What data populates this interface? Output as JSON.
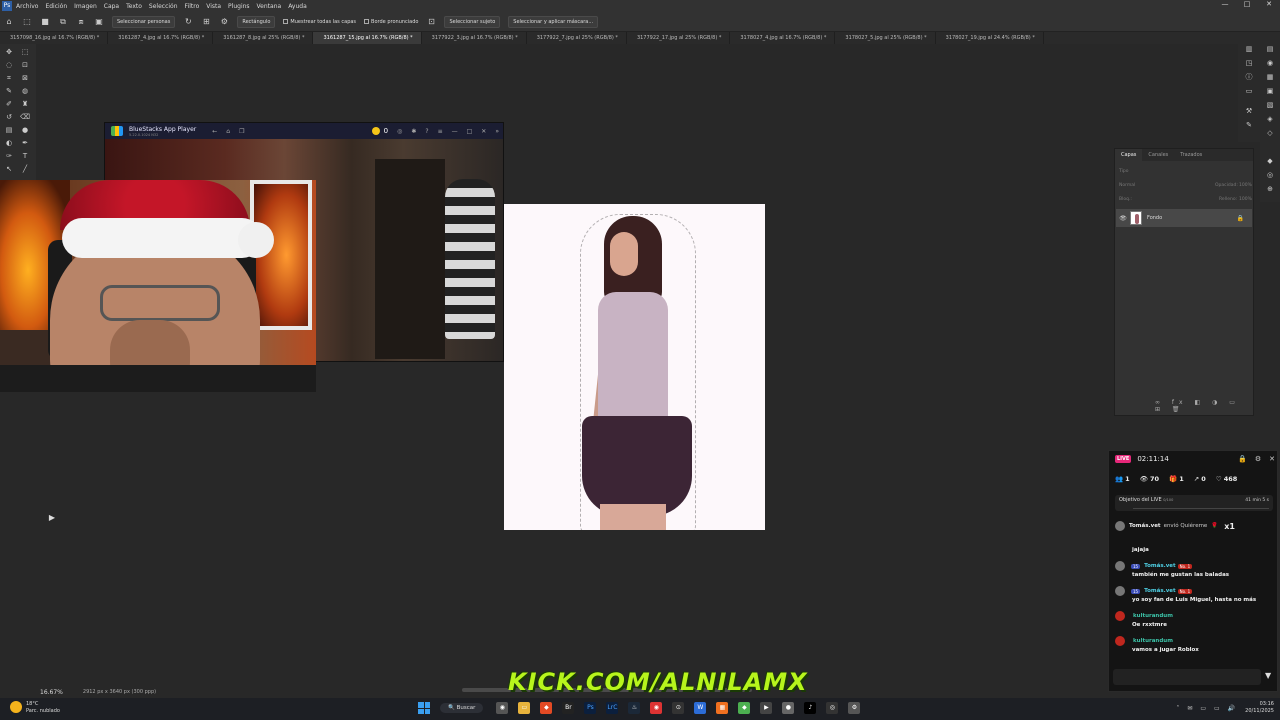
{
  "menubar": {
    "app_icon": "Ps",
    "items": [
      "Archivo",
      "Edición",
      "Imagen",
      "Capa",
      "Texto",
      "Selección",
      "Filtro",
      "Vista",
      "Plugins",
      "Ventana",
      "Ayuda"
    ]
  },
  "options_bar": {
    "select_people": "Seleccionar personas",
    "rect_label": "Rectángulo",
    "sample_all_layers": "Muestrear todas las capas",
    "hard_edge": "Borde pronunciado",
    "select_subject": "Seleccionar sujeto",
    "select_mask": "Seleccionar y aplicar máscara..."
  },
  "tabs": [
    "3157098_16.jpg al 16.7% (RGB/8) *",
    "3161287_4.jpg al 16.7% (RGB/8) *",
    "3161287_8.jpg al 25% (RGB/8) *",
    "3161287_15.jpg al 16.7% (RGB/8) *",
    "3177922_3.jpg al 16.7% (RGB/8) *",
    "3177922_7.jpg al 25% (RGB/8) *",
    "3177922_17.jpg al 25% (RGB/8) *",
    "3178027_4.jpg al 16.7% (RGB/8) *",
    "3178027_5.jpg al 25% (RGB/8) *",
    "3178027_19.jpg al 24.4% (RGB/8) *"
  ],
  "active_tab_index": 3,
  "layers_panel": {
    "tabs": [
      "Capas",
      "Canales",
      "Trazados"
    ],
    "search_placeholder": "Tipo",
    "blend_mode": "Normal",
    "opacity_label": "Opacidad:",
    "opacity_value": "100%",
    "lock_label": "Bloq.:",
    "fill_label": "Relleno:",
    "fill_value": "100%",
    "layer_name": "Fondo"
  },
  "bluestacks": {
    "title": "BlueStacks App Player",
    "subtitle": "5.22.0.1024 N32",
    "coins": "0"
  },
  "status": {
    "zoom": "16.67%",
    "dims": "2912 px x 3640 px (300 ppp)"
  },
  "overlay": {
    "kick_text": "KICK.COM/ALNILAMX"
  },
  "live": {
    "badge": "LIVE",
    "time": "02:11:14",
    "stats": {
      "users": "1",
      "viewers": "70",
      "gifts": "1",
      "shares": "0",
      "likes": "468"
    },
    "goal_label": "Objetivo del LIVE",
    "goal_count": "0/100",
    "goal_timer": "41 min 5 s",
    "goal_progress": 0.0,
    "gift": {
      "user": "Tomás.vet",
      "text": "envió Quiéreme",
      "count": "x1"
    },
    "messages": [
      {
        "plain": "jajaja"
      },
      {
        "level": "15",
        "user": "Tomás.vet",
        "rank": "No. 1",
        "text": "también me gustan las baladas"
      },
      {
        "level": "15",
        "user": "Tomás.vet",
        "rank": "No. 1",
        "text": "yo soy fan de Luis Miguel, hasta no más"
      },
      {
        "user": "kulturandum",
        "text": "Oe rxxtmre"
      },
      {
        "user": "kulturandum",
        "text": "vamos a jugar Roblox"
      }
    ],
    "accent_color": "#e6287a"
  },
  "taskbar": {
    "temp": "18°C",
    "weather": "Parc. nublado",
    "search_label": "Buscar",
    "time": "03:16",
    "date": "20/11/2025"
  }
}
